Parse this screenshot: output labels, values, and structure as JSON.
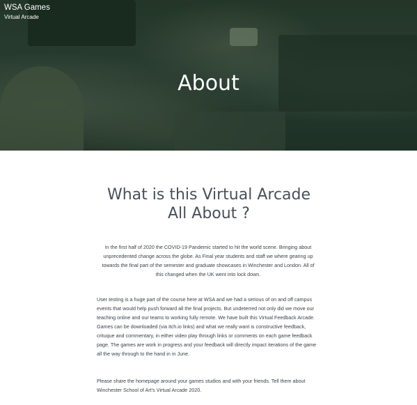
{
  "header": {
    "brand_title": "WSA Games",
    "brand_subtitle": "Virtual Arcade"
  },
  "hero": {
    "title": "About"
  },
  "main": {
    "heading": "What is this Virtual Arcade All About ?",
    "paragraphs": [
      "In the first half of 2020 the COVID-19 Pandemic started to hit the world scene. Bringing about unprecedented change across the globe. As Final year students and staff we where gearing up towards the final part of the semester and graduate showcases in Winchester and London. All of this changed when the UK went into lock down.",
      "User testing is a huge part of the course here at WSA and we had a serious of on and off campus events that would help push forward all the final projects. But undeterred not only did we move our teaching online and our teams to working fully remote. We have built this Virtual Feedback Arcade. Games can be downloaded (via itch.io links) and what we really want is constructive feedback, crituque and commentary, in either video play through links or comments on each game feedback page. The games are work in progress and your feedback will directly impact iterations of the game all the way through to the hand in in June.",
      "Please share the homepage around your games studios and with your friends. Tell them about Winchester School of Art's Virtual Arcade 2020."
    ]
  }
}
